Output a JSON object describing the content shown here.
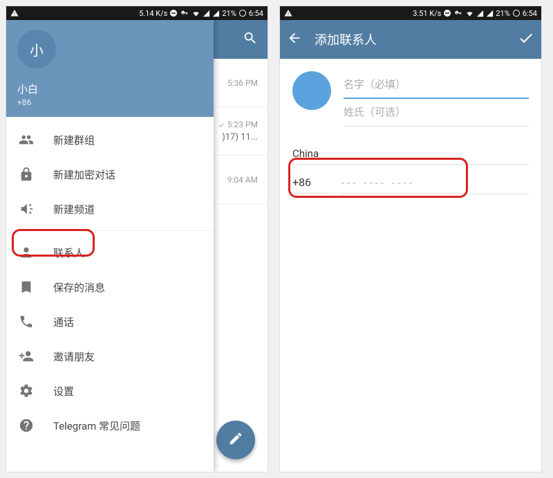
{
  "status": {
    "left_speed": "5.14 K/s",
    "right_speed": "3.51 K/s",
    "battery": "21%",
    "time": "6:54"
  },
  "left": {
    "avatar_letter": "小",
    "user_name": "小白",
    "user_phone": "+86",
    "menu": {
      "new_group": "新建群组",
      "new_secret": "新建加密对话",
      "new_channel": "新建频道",
      "contacts": "联系人",
      "saved": "保存的消息",
      "calls": "通话",
      "invite": "邀请朋友",
      "settings": "设置",
      "faq": "Telegram 常见问题"
    },
    "chats": {
      "time1": "5:36 PM",
      "time2": "5:23 PM",
      "sub2": ")17) 11...",
      "time3": "9:04 AM"
    }
  },
  "right": {
    "title": "添加联系人",
    "first_name_placeholder": "名字（必填）",
    "last_name_placeholder": "姓氏（可选）",
    "country": "China",
    "code": "+86",
    "phone_placeholder": "--- ---- ----"
  }
}
